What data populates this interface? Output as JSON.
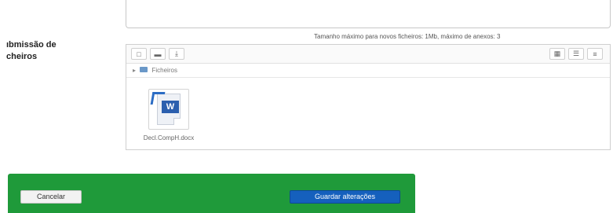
{
  "form": {
    "label_line1": "ıbmissão de",
    "label_line2": "cheiros",
    "size_note": "Tamanho máximo para novos ficheiros: 1Mb, máximo de anexos: 3"
  },
  "filemanager": {
    "toolbar": {
      "left_buttons": [
        {
          "icon": "add-file-icon",
          "glyph": "□"
        },
        {
          "icon": "create-folder-icon",
          "glyph": "▬"
        },
        {
          "icon": "download-icon",
          "glyph": "⤓"
        }
      ],
      "view_buttons": [
        {
          "icon": "view-icons-icon",
          "glyph": "▦"
        },
        {
          "icon": "view-list-icon",
          "glyph": "☰"
        },
        {
          "icon": "view-tree-icon",
          "glyph": "≡"
        }
      ]
    },
    "path": {
      "folder_label": "Ficheiros"
    },
    "files": [
      {
        "name": "Decl.CompH.docx",
        "icon": "word-document-icon",
        "badge": "W"
      }
    ]
  },
  "actions": {
    "cancel_label": "Cancelar",
    "save_label": "Guardar alterações",
    "bar_color": "#1f9a3a",
    "save_color": "#1560bd"
  }
}
